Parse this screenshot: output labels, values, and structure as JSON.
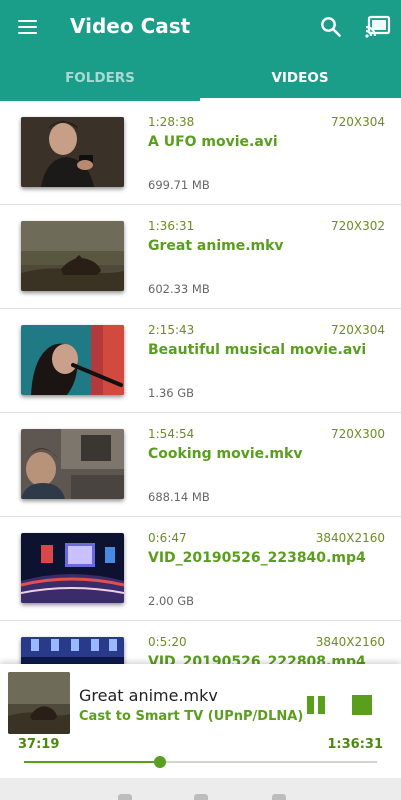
{
  "app": {
    "title": "Video Cast",
    "accent_color": "#1a9e8a",
    "text_green": "#5a9e1e",
    "icons": [
      "menu-icon",
      "search-icon",
      "cast-connected-icon"
    ]
  },
  "tabs": [
    {
      "label": "FOLDERS",
      "selected": false
    },
    {
      "label": "VIDEOS",
      "selected": true
    }
  ],
  "videos": [
    {
      "duration": "1:28:38",
      "resolution": "720X304",
      "title": "A UFO movie.avi",
      "size": "699.71 MB",
      "thumb": "man-with-phone"
    },
    {
      "duration": "1:36:31",
      "resolution": "720X302",
      "title": "Great anime.mkv",
      "size": "602.33 MB",
      "thumb": "landscape-creature"
    },
    {
      "duration": "2:15:43",
      "resolution": "720X304",
      "title": "Beautiful musical movie.avi",
      "size": "1.36 GB",
      "thumb": "singer-microphone"
    },
    {
      "duration": "1:54:54",
      "resolution": "720X300",
      "title": "Cooking movie.mkv",
      "size": "688.14 MB",
      "thumb": "kitchen-family"
    },
    {
      "duration": "0:6:47",
      "resolution": "3840X2160",
      "title": "VID_20190526_223840.mp4",
      "size": "2.00 GB",
      "thumb": "concert-stage"
    },
    {
      "duration": "0:5:20",
      "resolution": "3840X2160",
      "title": "VID_20190526_222808.mp4",
      "size": "",
      "thumb": "concert-blue"
    }
  ],
  "player": {
    "title": "Great anime.mkv",
    "subtitle": "Cast to Smart TV (UPnP/DLNA)",
    "current_time": "37:19",
    "total_time": "1:36:31",
    "progress": 0.386,
    "thumb": "landscape-creature"
  }
}
